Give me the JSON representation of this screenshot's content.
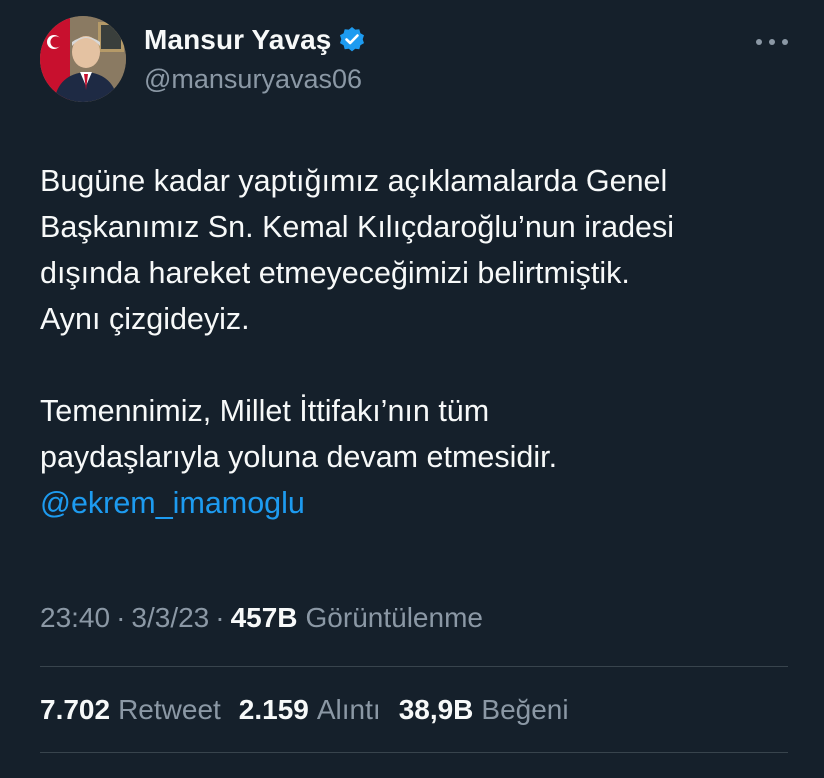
{
  "author": {
    "display_name": "Mansur Yavaş",
    "handle": "@mansuryavas06",
    "verified_badge_icon": "verified-badge-icon",
    "avatar_icon": "avatar-photo"
  },
  "more_icon": "more-options-icon",
  "tweet": {
    "paragraph1": [
      "Bugüne kadar yaptığımız açıklamalarda Genel",
      "Başkanımız Sn. Kemal Kılıçdaroğlu’nun iradesi",
      "dışında hareket etmeyeceğimizi belirtmiştik.",
      "Aynı çizgideyiz."
    ],
    "paragraph2": [
      "Temennimiz, Millet İttifakı’nın tüm",
      "paydaşlarıyla yoluna devam etmesidir."
    ],
    "mention": "@ekrem_imamoglu"
  },
  "meta": {
    "time": "23:40",
    "separator": "·",
    "date": "3/3/23",
    "views_count": "457B",
    "views_label": "Görüntülenme"
  },
  "stats": {
    "retweets_count": "7.702",
    "retweets_label": "Retweet",
    "quotes_count": "2.159",
    "quotes_label": "Alıntı",
    "likes_count": "38,9B",
    "likes_label": "Beğeni"
  },
  "colors": {
    "background": "#15202b",
    "text_primary": "#f7f9f9",
    "text_secondary": "#8b98a5",
    "link": "#1d9bf0",
    "divider": "#38444d"
  }
}
